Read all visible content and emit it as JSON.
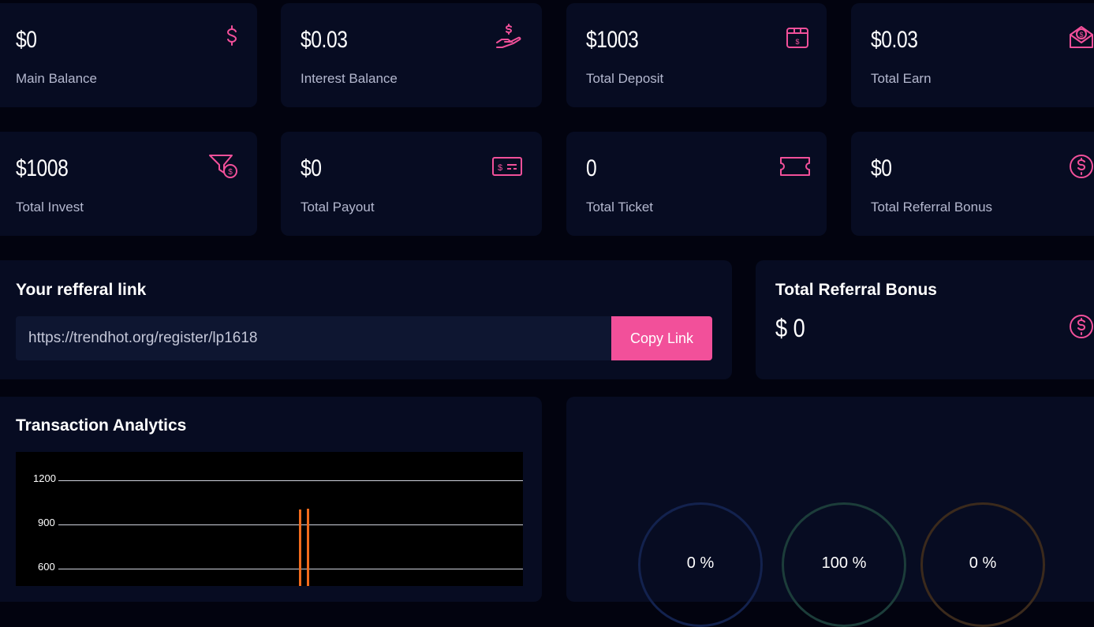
{
  "stats": [
    {
      "value": "$0",
      "label": "Main Balance",
      "icon": "dollar-icon"
    },
    {
      "value": "$0.03",
      "label": "Interest Balance",
      "icon": "hand-coin-icon"
    },
    {
      "value": "$1003",
      "label": "Total Deposit",
      "icon": "deposit-box-icon"
    },
    {
      "value": "$0.03",
      "label": "Total Earn",
      "icon": "envelope-coin-icon"
    },
    {
      "value": "$1008",
      "label": "Total Invest",
      "icon": "funnel-coin-icon"
    },
    {
      "value": "$0",
      "label": "Total Payout",
      "icon": "card-icon"
    },
    {
      "value": "0",
      "label": "Total Ticket",
      "icon": "ticket-icon"
    },
    {
      "value": "$0",
      "label": "Total Referral Bonus",
      "icon": "dollar-circle-icon"
    }
  ],
  "referral": {
    "title": "Your refferal link",
    "link": "https://trendhot.org/register/lp1618",
    "copy_label": "Copy Link"
  },
  "referral_bonus": {
    "title": "Total Referral Bonus",
    "value": "$ 0"
  },
  "analytics": {
    "title": "Transaction Analytics"
  },
  "chart_data": {
    "type": "bar",
    "y_ticks": [
      "1200",
      "900",
      "600"
    ],
    "ylim": [
      600,
      1200
    ],
    "values": [
      1003,
      1008
    ]
  },
  "rings": [
    {
      "label": "0 %",
      "color": "#13224e"
    },
    {
      "label": "100 %",
      "color": "#1c3d3a"
    },
    {
      "label": "0 %",
      "color": "#3b2a1c"
    }
  ],
  "colors": {
    "accent": "#f2509a",
    "card": "#070c22",
    "background": "#02030f"
  }
}
